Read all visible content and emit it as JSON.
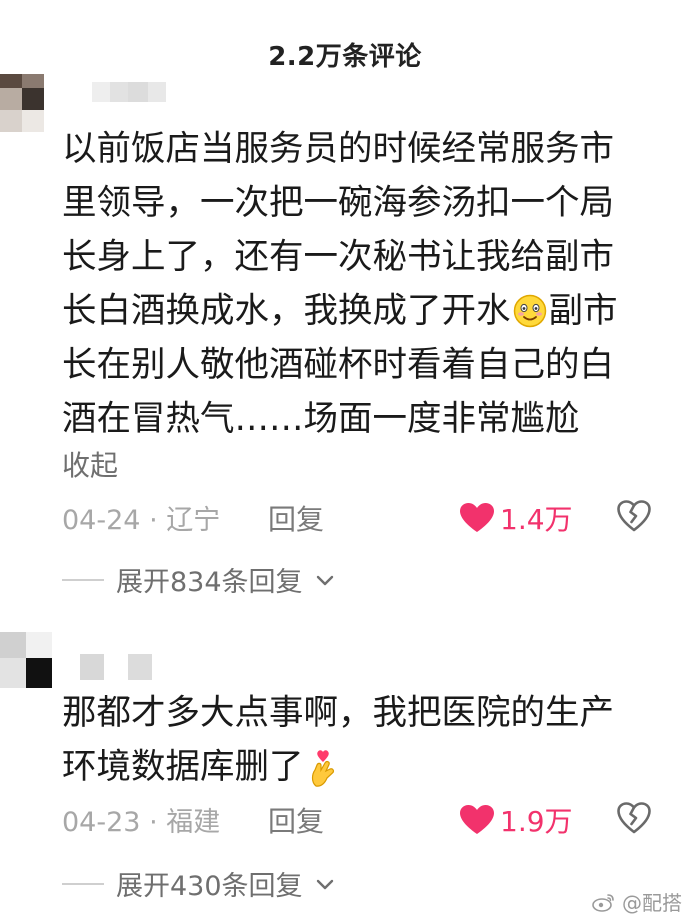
{
  "header": {
    "title": "2.2万条评论"
  },
  "comments": [
    {
      "lines": [
        "以前饭店当服务员的时候经常服务市",
        "里领导，一次把一碗海参汤扣一个局",
        "长身上了，还有一次秘书让我给副市",
        "长白酒换成水，我换成了开水",
        "副市",
        "长在别人敬他酒碰杯时看着自己的白",
        "酒在冒热气……场面一度非常尴尬"
      ],
      "inline_emoji": "blush-smile-emoji",
      "collapse_label": "收起",
      "date": "04-24",
      "separator": "·",
      "location": "辽宁",
      "reply_label": "回复",
      "likes": "1.4万",
      "expand_label": "展开834条回复"
    },
    {
      "lines": [
        "那都才多大点事啊，我把医院的生产",
        "环境数据库删了"
      ],
      "inline_emoji": "heart-fingers-emoji",
      "date": "04-23",
      "separator": "·",
      "location": "福建",
      "reply_label": "回复",
      "likes": "1.9万",
      "expand_label": "展开430条回复"
    }
  ],
  "watermark": {
    "text": "@配搭",
    "icon": "weibo-icon"
  },
  "colors": {
    "like": "#f2326c",
    "meta": "#a7a7a7",
    "text": "#1a1a1a"
  }
}
